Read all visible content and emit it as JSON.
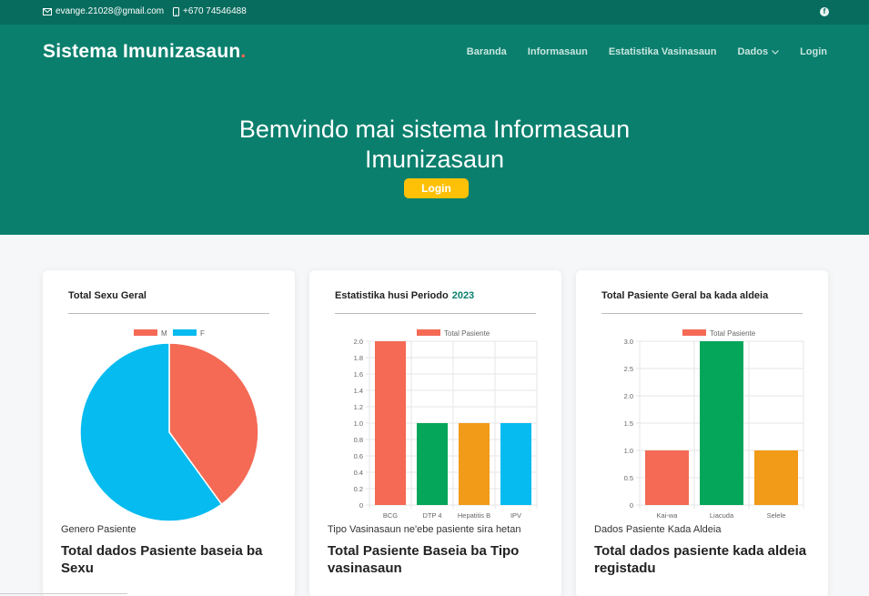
{
  "topbar": {
    "email": "evange.21028@gmail.com",
    "phone": "+670 74546488"
  },
  "header": {
    "brand": "Sistema Imunizasaun",
    "brand_dot": ".",
    "nav": [
      "Baranda",
      "Informasaun",
      "Estatistika Vasinasaun",
      "Dados",
      "Login"
    ]
  },
  "hero": {
    "title_line1": "Bemvindo mai sistema Informasaun",
    "title_line2": "Imunizasaun",
    "button": "Login"
  },
  "cards": [
    {
      "title": "Total Sexu Geral",
      "caption": "Genero Pasiente",
      "footer_title": "Total dados Pasiente baseia ba Sexu"
    },
    {
      "title": "Estatistika husi Periodo",
      "year": "2023",
      "caption": "Tipo Vasinasaun ne'ebe pasiente sira hetan",
      "footer_title": "Total Pasiente Baseia ba Tipo vasinasaun"
    },
    {
      "title": "Total Pasiente Geral ba kada aldeia",
      "caption": "Dados Pasiente Kada Aldeia",
      "footer_title": "Total dados pasiente kada aldeia registadu"
    }
  ],
  "chart_data": [
    {
      "type": "pie",
      "categories": [
        "M",
        "F"
      ],
      "values": [
        2,
        3
      ],
      "colors": [
        "#f46a55",
        "#06bbef"
      ],
      "legend": "top"
    },
    {
      "type": "bar",
      "categories": [
        "BCG",
        "DTP 4",
        "Hepatitis B",
        "IPV"
      ],
      "series": [
        {
          "name": "Total Pasiente",
          "values": [
            2,
            1,
            1,
            1
          ]
        }
      ],
      "colors": [
        "#f46a55",
        "#06a65a",
        "#f29b18",
        "#06bbef"
      ],
      "ylim": [
        0,
        2
      ],
      "yticks": [
        "0",
        "0.2",
        "0.4",
        "0.6",
        "0.8",
        "1.0",
        "1.2",
        "1.4",
        "1.6",
        "1.8",
        "2.0"
      ],
      "legend": "top"
    },
    {
      "type": "bar",
      "categories": [
        "Kai-wa",
        "Liacuda",
        "Selele"
      ],
      "series": [
        {
          "name": "Total Pasiente",
          "values": [
            1,
            3,
            1
          ]
        }
      ],
      "colors": [
        "#f46a55",
        "#06a65a",
        "#f29b18"
      ],
      "ylim": [
        0,
        3
      ],
      "yticks": [
        "0",
        "0.5",
        "1.0",
        "1.5",
        "2.0",
        "2.5",
        "3.0"
      ],
      "legend": "top"
    }
  ]
}
